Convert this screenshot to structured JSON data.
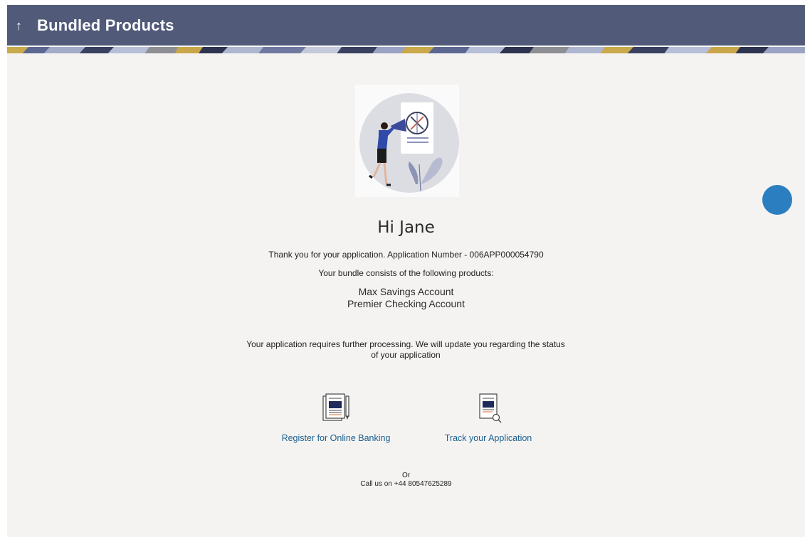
{
  "header": {
    "title": "Bundled Products",
    "back_glyph": "↑"
  },
  "confirmation": {
    "greeting": "Hi Jane",
    "thank_you": "Thank you for your application. Application Number - 006APP000054790",
    "bundle_intro": "Your bundle consists of the following products:",
    "products": [
      "Max Savings Account",
      "Premier Checking Account"
    ],
    "processing_note": "Your application requires further processing. We will update you regarding the status of your application"
  },
  "actions": {
    "register_label": "Register for Online Banking",
    "track_label": "Track your Application"
  },
  "contact": {
    "or_label": "Or",
    "call_label": "Call us on +44 80547625289"
  },
  "colors": {
    "header_bg": "#515a79",
    "page_bg": "#f4f3f2",
    "link": "#1a5f8f",
    "fab": "#2b7fc1"
  },
  "icons": {
    "back": "arrow-up-icon",
    "register": "newspaper-pen-icon",
    "track": "document-search-icon",
    "help": "help-fab-icon"
  }
}
